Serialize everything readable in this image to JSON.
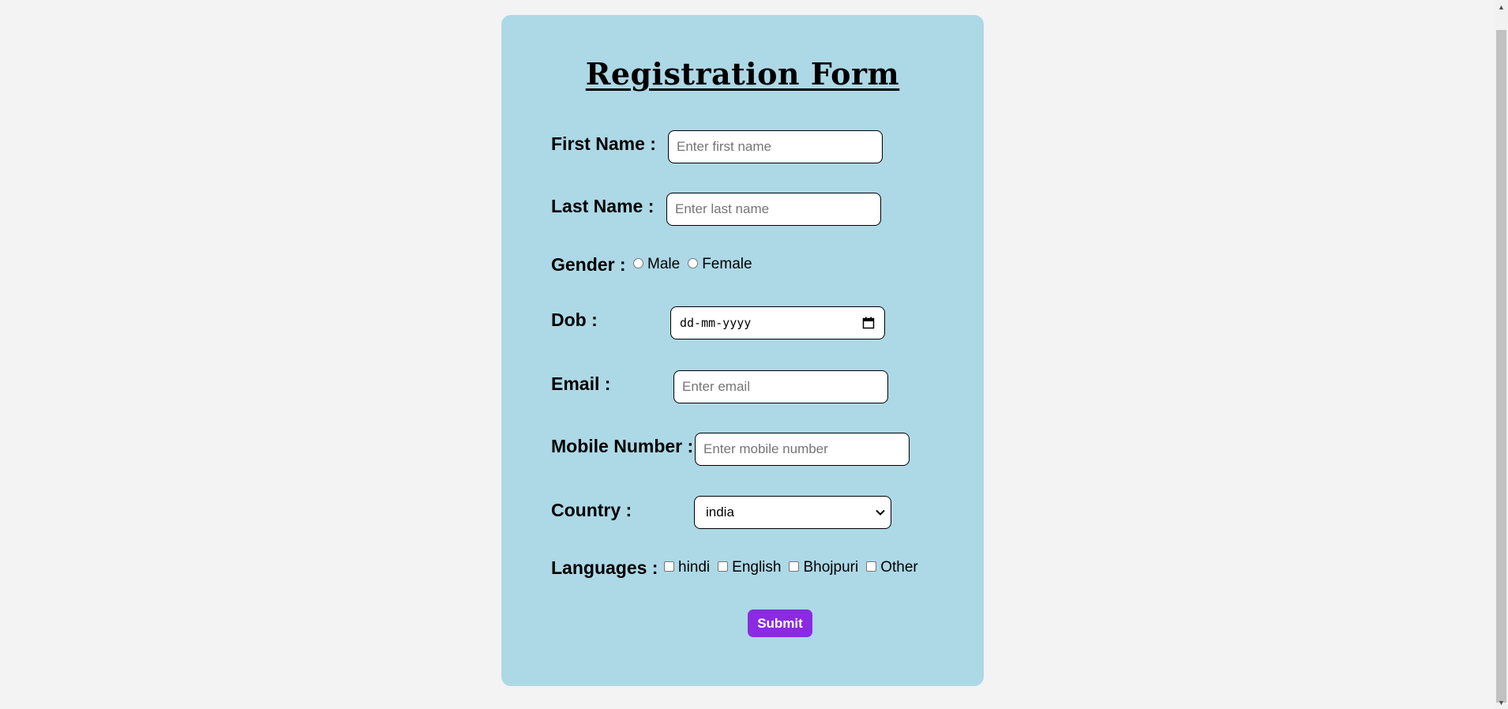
{
  "form": {
    "title": "Registration Form",
    "first_name": {
      "label": "First Name :",
      "placeholder": "Enter first name"
    },
    "last_name": {
      "label": "Last Name :",
      "placeholder": "Enter last name"
    },
    "gender": {
      "label": "Gender :",
      "options": [
        "Male",
        "Female"
      ]
    },
    "dob": {
      "label": "Dob :",
      "value": "dd-mm-yyyy"
    },
    "email": {
      "label": "Email :",
      "placeholder": "Enter email"
    },
    "mobile": {
      "label": "Mobile Number :",
      "placeholder": "Enter mobile number"
    },
    "country": {
      "label": "Country :",
      "selected": "india"
    },
    "languages": {
      "label": "Languages :",
      "options": [
        "hindi",
        "English",
        "Bhojpuri",
        "Other"
      ]
    },
    "submit_label": "Submit"
  },
  "colors": {
    "page_background": "#f3f3f3",
    "card_background": "#add8e6",
    "submit_background": "#8a2be2",
    "submit_text": "#ffffff"
  },
  "icons": {
    "calendar": "calendar-icon",
    "select_arrow": "chevron-down-icon",
    "scroll_up": "scroll-up-arrow-icon",
    "scroll_down": "scroll-down-arrow-icon"
  }
}
